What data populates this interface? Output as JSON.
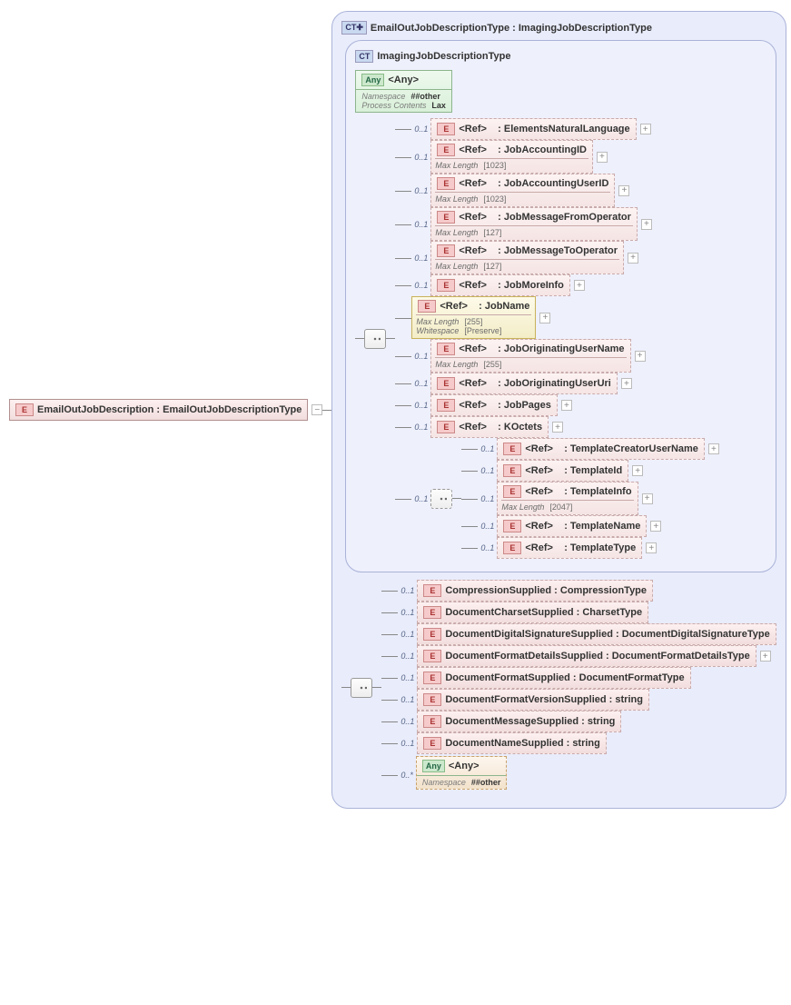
{
  "root": {
    "label": "EmailOutJobDescription : EmailOutJobDescriptionType"
  },
  "outerCT": {
    "label": "EmailOutJobDescriptionType : ImagingJobDescriptionType"
  },
  "innerCT": {
    "label": "ImagingJobDescriptionType"
  },
  "anyTop": {
    "label": "<Any>",
    "rows": [
      {
        "k": "Namespace",
        "v": "##other"
      },
      {
        "k": "Process Contents",
        "v": "Lax"
      }
    ]
  },
  "occ_opt": "0..1",
  "occ_many": "0..*",
  "refs": {
    "ElementsNaturalLanguage": {
      "name": ": ElementsNaturalLanguage"
    },
    "JobAccountingID": {
      "name": ": JobAccountingID",
      "facets": [
        [
          "Max Length",
          "[1023]"
        ]
      ]
    },
    "JobAccountingUserID": {
      "name": ": JobAccountingUserID",
      "facets": [
        [
          "Max Length",
          "[1023]"
        ]
      ]
    },
    "JobMessageFromOperator": {
      "name": ": JobMessageFromOperator",
      "facets": [
        [
          "Max Length",
          "[127]"
        ]
      ]
    },
    "JobMessageToOperator": {
      "name": ": JobMessageToOperator",
      "facets": [
        [
          "Max Length",
          "[127]"
        ]
      ]
    },
    "JobMoreInfo": {
      "name": ": JobMoreInfo"
    },
    "JobName": {
      "name": ": JobName",
      "facets": [
        [
          "Max Length",
          "[255]"
        ],
        [
          "Whitespace",
          "[Preserve]"
        ]
      ],
      "solid": true
    },
    "JobOriginatingUserName": {
      "name": ": JobOriginatingUserName",
      "facets": [
        [
          "Max Length",
          "[255]"
        ]
      ]
    },
    "JobOriginatingUserUri": {
      "name": ": JobOriginatingUserUri"
    },
    "JobPages": {
      "name": ": JobPages"
    },
    "KOctets": {
      "name": ": KOctets"
    },
    "TemplateCreatorUserName": {
      "name": ": TemplateCreatorUserName"
    },
    "TemplateId": {
      "name": ": TemplateId"
    },
    "TemplateInfo": {
      "name": ": TemplateInfo",
      "facets": [
        [
          "Max Length",
          "[2047]"
        ]
      ]
    },
    "TemplateName": {
      "name": ": TemplateName"
    },
    "TemplateType": {
      "name": ": TemplateType"
    }
  },
  "refLabel": "<Ref>",
  "outerElements": [
    {
      "name": "CompressionSupplied : CompressionType"
    },
    {
      "name": "DocumentCharsetSupplied : CharsetType"
    },
    {
      "name": "DocumentDigitalSignatureSupplied : DocumentDigitalSignatureType"
    },
    {
      "name": "DocumentFormatDetailsSupplied : DocumentFormatDetailsType",
      "expand": true
    },
    {
      "name": "DocumentFormatSupplied : DocumentFormatType"
    },
    {
      "name": "DocumentFormatVersionSupplied : string"
    },
    {
      "name": "DocumentMessageSupplied : string"
    },
    {
      "name": "DocumentNameSupplied : string"
    }
  ],
  "anyBottom": {
    "label": "<Any>",
    "rows": [
      {
        "k": "Namespace",
        "v": "##other"
      }
    ]
  }
}
